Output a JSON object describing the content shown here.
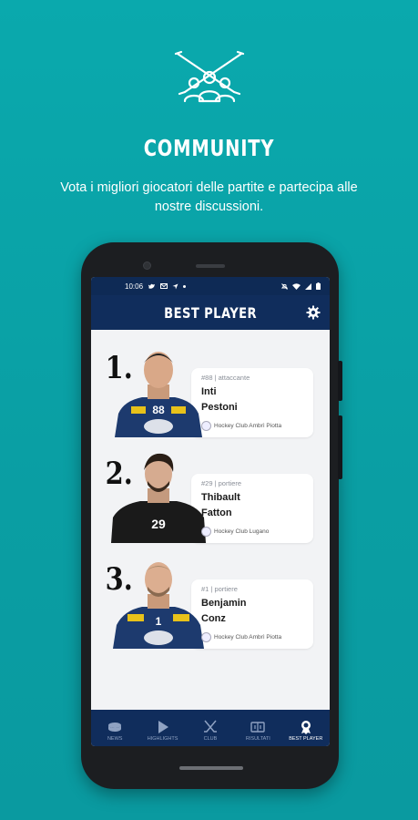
{
  "hero": {
    "icon": "community-hockey-icon",
    "title": "COMMUNITY",
    "subtitle": "Vota i migliori giocatori delle partite e partecipa alle nostre discussioni."
  },
  "status_bar": {
    "time": "10:06"
  },
  "app_bar": {
    "title": "BEST PLAYER",
    "settings_icon": "gear-icon"
  },
  "players": [
    {
      "rank": "1.",
      "position": "#88 | attaccante",
      "first_name": "Inti",
      "last_name": "Pestoni",
      "club": "Hockey Club Ambrì Piotta",
      "jersey_number": "88",
      "jersey_color": "#1d3a6e"
    },
    {
      "rank": "2.",
      "position": "#29 | portiere",
      "first_name": "Thibault",
      "last_name": "Fatton",
      "club": "Hockey Club Lugano",
      "jersey_number": "29",
      "jersey_color": "#1a1a1a"
    },
    {
      "rank": "3.",
      "position": "#1 | portiere",
      "first_name": "Benjamin",
      "last_name": "Conz",
      "club": "Hockey Club Ambrì Piotta",
      "jersey_number": "1",
      "jersey_color": "#1d3a6e"
    }
  ],
  "nav": [
    {
      "label": "NEWS",
      "icon": "puck-icon",
      "active": false
    },
    {
      "label": "HIGHLIGHTS",
      "icon": "play-icon",
      "active": false
    },
    {
      "label": "CLUB",
      "icon": "crossed-sticks-icon",
      "active": false
    },
    {
      "label": "RISULTATI",
      "icon": "scoreboard-icon",
      "active": false
    },
    {
      "label": "BEST PLAYER",
      "icon": "medal-icon",
      "active": true
    }
  ],
  "colors": {
    "background": "#0aa9ad",
    "app_primary": "#102d5c",
    "accent_white": "#ffffff"
  }
}
